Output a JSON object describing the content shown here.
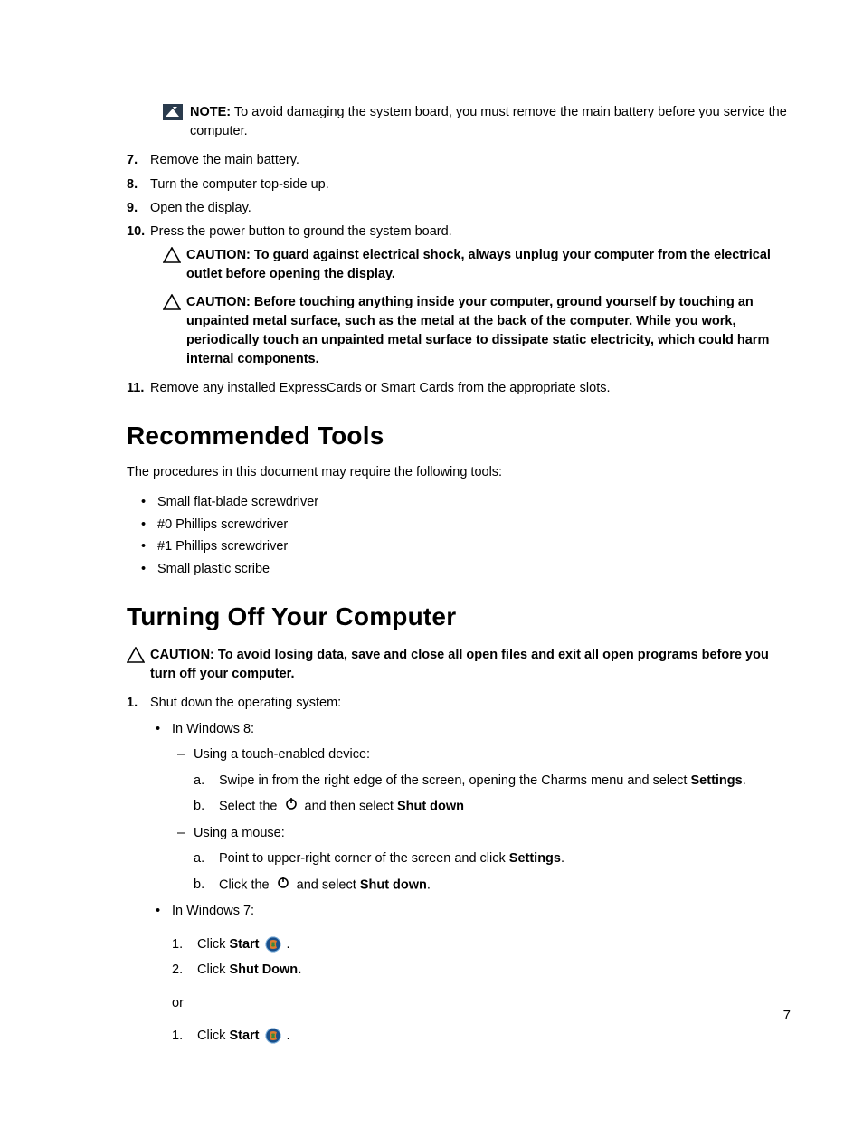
{
  "note": {
    "label": "NOTE:",
    "text": " To avoid damaging the system board, you must remove the main battery before you service the computer."
  },
  "steps": {
    "7": "Remove the main battery.",
    "8": "Turn the computer top-side up.",
    "9": "Open the display.",
    "10": "Press the power button to ground the system board.",
    "11": "Remove any installed ExpressCards or Smart Cards from the appropriate slots."
  },
  "caution1": {
    "label": "CAUTION:",
    "text": " To guard against electrical shock, always unplug your computer from the electrical outlet before opening the display."
  },
  "caution2": {
    "label": "CAUTION:",
    "text": " Before touching anything inside your computer, ground yourself by touching an unpainted metal surface, such as the metal at the back of the computer. While you work, periodically touch an unpainted metal surface to dissipate static electricity, which could harm internal components."
  },
  "tools": {
    "heading": "Recommended Tools",
    "intro": "The procedures in this document may require the following tools:",
    "items": [
      "Small flat-blade screwdriver",
      "#0 Phillips screwdriver",
      "#1 Phillips screwdriver",
      "Small plastic scribe"
    ]
  },
  "turnoff": {
    "heading": "Turning Off Your Computer",
    "caution_label": "CAUTION:",
    "caution_text": " To avoid losing data, save and close all open files and exit all open programs before you turn off your computer.",
    "step1": "Shut down the operating system:",
    "win8_label": "In Windows 8:",
    "touch_label": "Using a touch-enabled device:",
    "touch_a_pre": "Swipe in from the right edge of the screen, opening the Charms menu and select ",
    "touch_a_bold": "Settings",
    "touch_a_post": ".",
    "touch_b_pre": "Select the ",
    "touch_b_mid": " and then select ",
    "touch_b_bold": "Shut down",
    "mouse_label": "Using a mouse:",
    "mouse_a_pre": "Point to upper-right corner of the screen and click ",
    "mouse_a_bold": "Settings",
    "mouse_a_post": ".",
    "mouse_b_pre": "Click the ",
    "mouse_b_mid": " and select ",
    "mouse_b_bold": "Shut down",
    "mouse_b_post": ".",
    "win7_label": "In Windows 7:",
    "win7_1_pre": "Click ",
    "win7_1_bold": "Start ",
    "win7_1_post": " .",
    "win7_2_pre": "Click ",
    "win7_2_bold": "Shut Down.",
    "or": "or",
    "win7_alt1_pre": "Click ",
    "win7_alt1_bold": "Start ",
    "win7_alt1_post": " ."
  },
  "page_number": "7"
}
